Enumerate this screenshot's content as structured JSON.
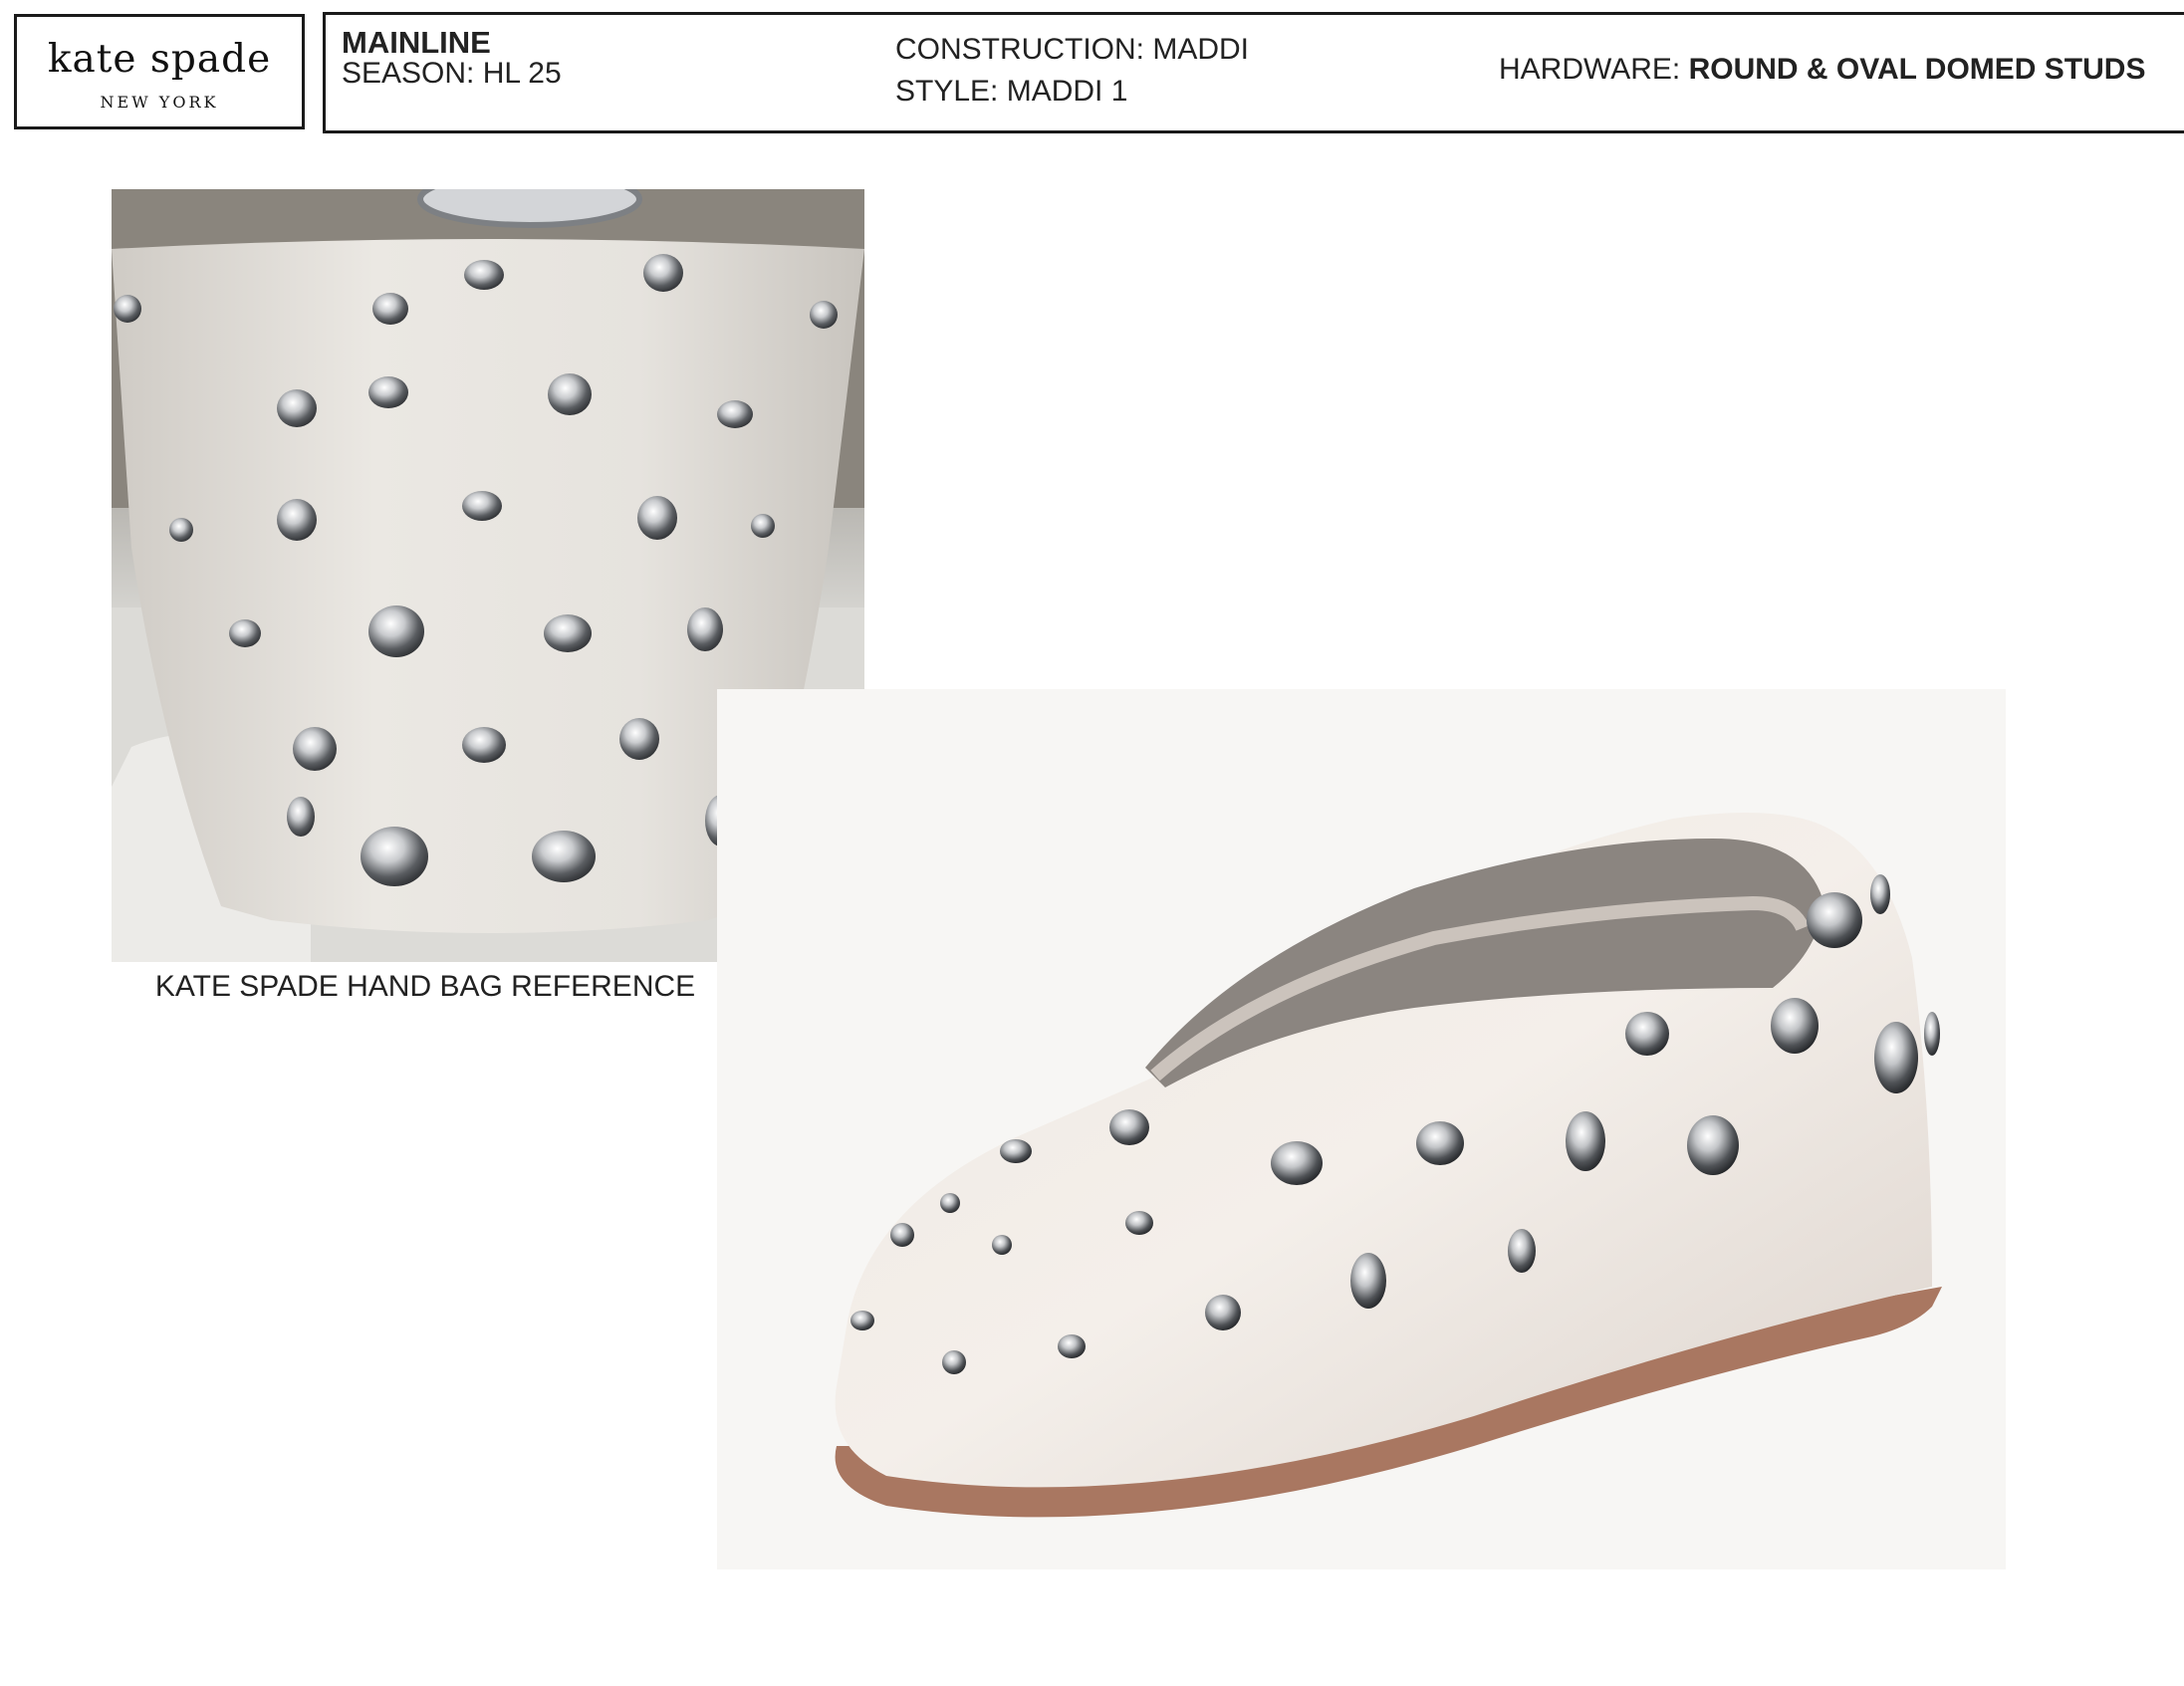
{
  "header": {
    "logo_name": "kate spade",
    "logo_city": "NEW YORK",
    "line": "MAINLINE",
    "season": "SEASON: HL 25",
    "construction": "CONSTRUCTION: MADDI",
    "style": "STYLE: MADDI 1",
    "hardware_label": "HARDWARE: ",
    "hardware_value": "ROUND & OVAL DOMED STUDS"
  },
  "reference": {
    "caption": "KATE SPADE HAND BAG REFERENCE"
  },
  "colors": {
    "bag_leather": "#e4e1dc",
    "shoe_leather": "#ede6e0",
    "sole": "#a97761",
    "stud_metal": "#b9bcc0"
  }
}
